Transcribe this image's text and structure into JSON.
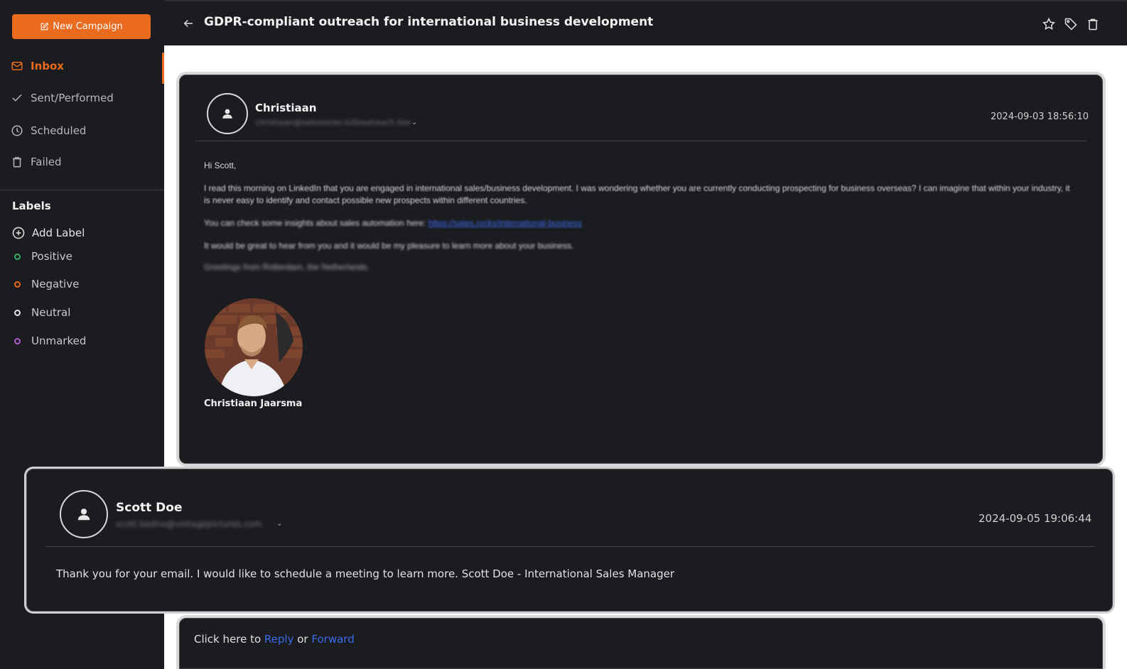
{
  "sidebar": {
    "new_campaign_label": "New Campaign",
    "nav": [
      {
        "label": "Inbox",
        "icon": "mail-icon",
        "active": true
      },
      {
        "label": "Sent/Performed",
        "icon": "check-icon"
      },
      {
        "label": "Scheduled",
        "icon": "clock-icon"
      },
      {
        "label": "Failed",
        "icon": "trash-icon"
      }
    ],
    "labels_title": "Labels",
    "add_label": "Add Label",
    "labels": [
      {
        "label": "Positive",
        "color": "#35b06a"
      },
      {
        "label": "Negative",
        "color": "#ea6a1e"
      },
      {
        "label": "Neutral",
        "color": "#e6e6e6"
      },
      {
        "label": "Unmarked",
        "color": "#b05ad0"
      }
    ]
  },
  "header": {
    "subject": "GDPR-compliant outreach for international business development",
    "icons": [
      "star-icon",
      "tag-icon",
      "trash-icon"
    ]
  },
  "message1": {
    "sender": "Christiaan",
    "email": "christiaan@salesrocks-b2boutreach.live",
    "date": "2024-09-03 18:56:10",
    "greeting": "Hi Scott,",
    "paragraph1": "I read this morning on LinkedIn that you are engaged in international sales/business development. I was wondering whether you are currently conducting prospecting for business overseas? I can imagine that within your industry, it is never easy to identify and contact possible new prospects within different countries.",
    "paragraph2_prefix": "You can check some insights about sales automation here:",
    "paragraph2_link": "https://sales.rocks/international-business",
    "paragraph3": "It would be great to hear from you and it would be my pleasure to learn more about your business.",
    "paragraph4": "Greetings from Rotterdam, the Netherlands.",
    "signature_name": "Christiaan Jaarsma"
  },
  "message2": {
    "sender": "Scott Doe",
    "email": "scott.bedno@vintagepictures.com",
    "date": "2024-09-05 19:06:44",
    "body": "Thank you for your email. I would like to schedule a meeting to learn more. Scott Doe - International Sales Manager"
  },
  "reply_bar": {
    "prefix": "Click here to",
    "reply": "Reply",
    "or": "or",
    "forward": "Forward"
  }
}
